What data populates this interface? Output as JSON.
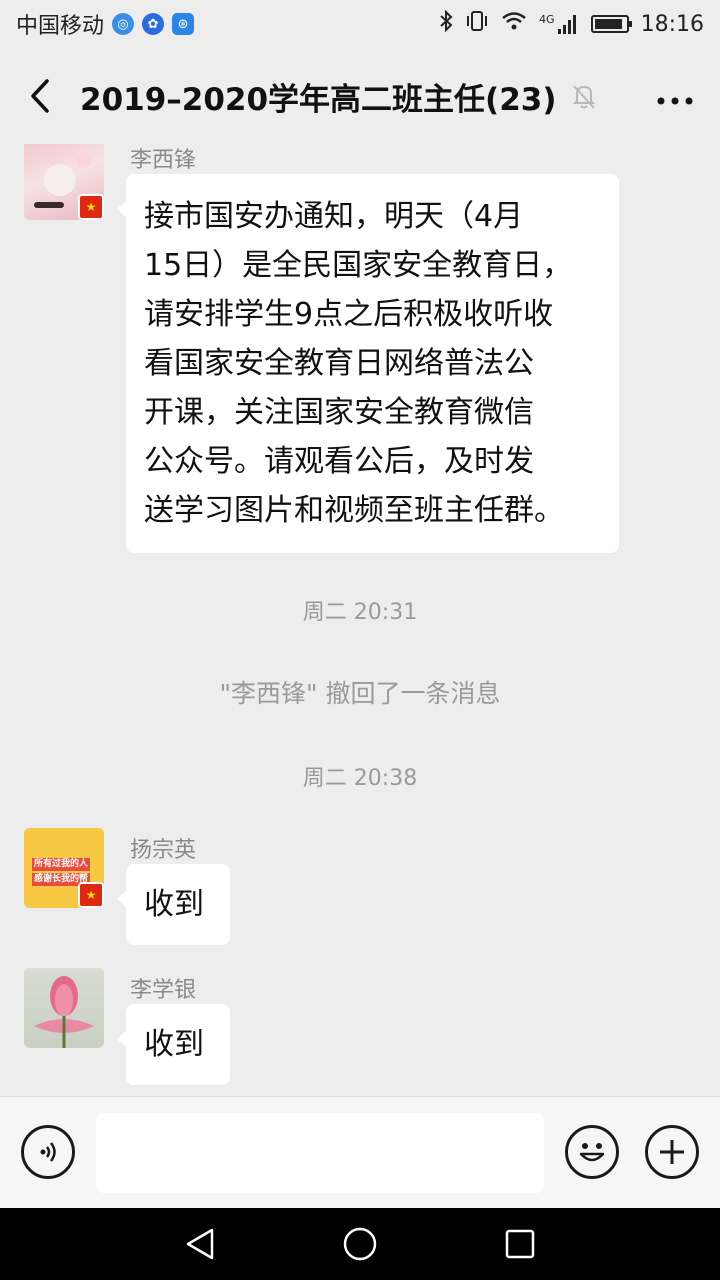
{
  "status_bar": {
    "carrier": "中国移动",
    "time": "18:16",
    "network": "4G",
    "battery_level": 0.9
  },
  "header": {
    "back_icon": "chevron-left-icon",
    "title": "2019–2020学年高二班主任(23)",
    "mute_icon": "bell-off-icon",
    "more_icon": "more-dots-icon"
  },
  "messages": [
    {
      "sender": "李西锋",
      "text": "接市国安办通知，明天（4月15日）是全民国家安全教育日，请安排学生9点之后积极收听收看国家安全教育日网络普法公开课，关注国家安全教育微信公众号。请观看公后，及时发送学习图片和视频至班主任群。",
      "lines": [
        "接市国安办通知，明天（4月",
        "15日）是全民国家安全教育日，",
        "请安排学生9点之后积极收听收",
        "看国家安全教育日网络普法公",
        "开课，关注国家安全教育微信",
        "公众号。请观看公后，及时发",
        "送学习图片和视频至班主任群。"
      ]
    },
    {
      "timestamp": "周二 20:31"
    },
    {
      "system": "\"李西锋\" 撤回了一条消息"
    },
    {
      "timestamp": "周二 20:38"
    },
    {
      "sender": "扬宗英",
      "text": "收到",
      "avatar_text": [
        "所有过我的人",
        "感谢长我的帮"
      ]
    },
    {
      "sender": "李学银",
      "text": "收到"
    }
  ],
  "input_bar": {
    "voice_icon": "voice-icon",
    "input_value": "",
    "emoji_icon": "emoji-icon",
    "plus_icon": "plus-icon"
  },
  "nav_bar": {
    "back": "nav-back-icon",
    "home": "nav-home-icon",
    "recent": "nav-recent-icon"
  },
  "colors": {
    "background": "#ededed",
    "bubble": "#ffffff",
    "sender": "#8a8a8a",
    "system_text": "#9a9a9a",
    "flag_red": "#de2910"
  }
}
